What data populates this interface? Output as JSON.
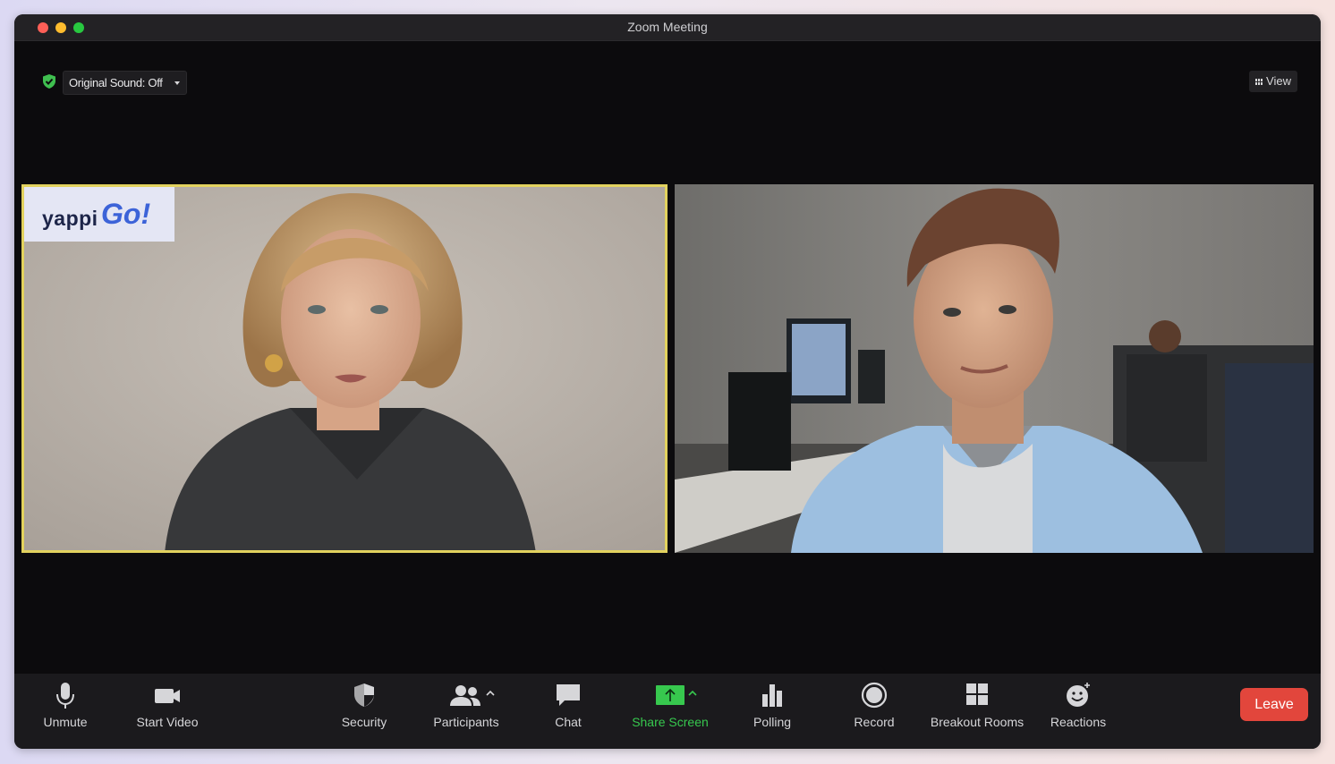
{
  "window": {
    "title": "Zoom Meeting"
  },
  "top_bar": {
    "original_sound_label": "Original Sound: Off",
    "view_label": "View",
    "shield_color": "#3fbf4f"
  },
  "video": {
    "active_speaker_border": "#e2d25e",
    "logo": {
      "part1": "yappi",
      "part2": "Go!"
    }
  },
  "toolbar": {
    "unmute": "Unmute",
    "start_video": "Start Video",
    "security": "Security",
    "participants": "Participants",
    "chat": "Chat",
    "share_screen": "Share Screen",
    "polling": "Polling",
    "record": "Record",
    "breakout_rooms": "Breakout Rooms",
    "reactions": "Reactions",
    "leave": "Leave",
    "share_color": "#37c84e",
    "leave_color": "#e2463c"
  }
}
